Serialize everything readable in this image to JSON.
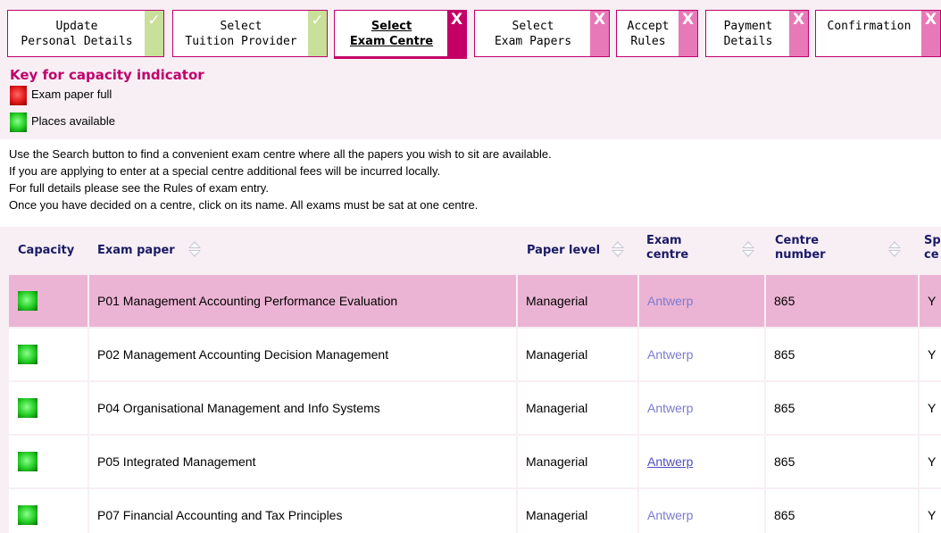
{
  "steps": [
    {
      "line1": "Update",
      "line2": "Personal Details",
      "status": "✓"
    },
    {
      "line1": "Select",
      "line2": "Tuition Provider",
      "status": "✓"
    },
    {
      "line1": "Select",
      "line2": "Exam Centre",
      "status": "X"
    },
    {
      "line1": "Select",
      "line2": "Exam Papers",
      "status": "X"
    },
    {
      "line1": "Accept",
      "line2": "Rules",
      "status": "X"
    },
    {
      "line1": "Payment",
      "line2": "Details",
      "status": "X"
    },
    {
      "line1": "Confirmation",
      "line2": "",
      "status": "X"
    }
  ],
  "key": {
    "title": "Key for capacity indicator",
    "full": "Exam paper full",
    "available": "Places available"
  },
  "instructions": [
    "Use the Search button to find a convenient exam centre where all the papers you wish to sit are available.",
    "If you are applying to enter at a special centre additional fees will be incurred locally.",
    "For full details please see the Rules of exam entry.",
    "Once you have decided on a centre, click on its name. All exams must be sat at one centre."
  ],
  "table": {
    "headers": {
      "capacity": "Capacity",
      "exam_paper": "Exam paper",
      "paper_level": "Paper level",
      "exam_centre_1": "Exam",
      "exam_centre_2": "centre",
      "centre_number_1": "Centre",
      "centre_number_2": "number",
      "special_1": "Sp",
      "special_2": "ce"
    },
    "rows": [
      {
        "paper": "P01 Management Accounting Performance Evaluation",
        "level": "Managerial",
        "centre": "Antwerp",
        "number": "865",
        "special": "Y"
      },
      {
        "paper": "P02 Management Accounting Decision Management",
        "level": "Managerial",
        "centre": "Antwerp",
        "number": "865",
        "special": "Y"
      },
      {
        "paper": "P04 Organisational Management and Info Systems",
        "level": "Managerial",
        "centre": "Antwerp",
        "number": "865",
        "special": "Y"
      },
      {
        "paper": "P05 Integrated Management",
        "level": "Managerial",
        "centre": "Antwerp",
        "number": "865",
        "special": "Y"
      },
      {
        "paper": "P07 Financial Accounting and Tax Principles",
        "level": "Managerial",
        "centre": "Antwerp",
        "number": "865",
        "special": "Y"
      }
    ]
  },
  "colors": {
    "accent": "#c0006a",
    "done": "#c8e09a",
    "pending": "#e879b8",
    "selected_row": "#ecb4d4"
  }
}
